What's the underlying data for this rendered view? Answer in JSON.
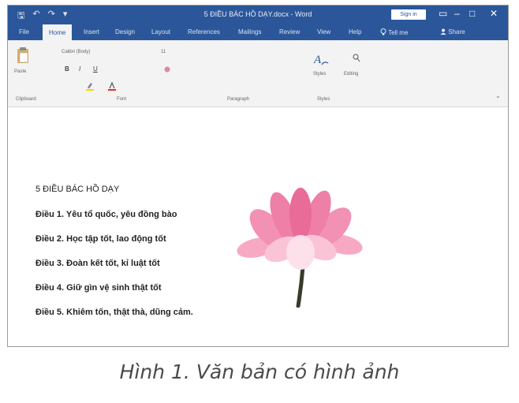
{
  "window": {
    "title": "5 ĐIỀU BÁC HỒ DẠY.docx - Word",
    "sign_in_label": "Sign in",
    "controls": {
      "restore": "▭",
      "minimize": "–",
      "maximize": "□",
      "close": "✕"
    }
  },
  "quick_access": {
    "save_icon": "🖫",
    "undo_icon": "↶",
    "redo_icon": "↷",
    "more_icon": "▾"
  },
  "tabs": [
    {
      "label": "File"
    },
    {
      "label": "Home"
    },
    {
      "label": "Insert"
    },
    {
      "label": "Design"
    },
    {
      "label": "Layout"
    },
    {
      "label": "References"
    },
    {
      "label": "Mailings"
    },
    {
      "label": "Review"
    },
    {
      "label": "View"
    },
    {
      "label": "Help"
    },
    {
      "label": "Tell me"
    },
    {
      "label": "Share"
    }
  ],
  "ribbon": {
    "paste_label": "Paste",
    "font_name": "Calibri (Body)",
    "font_size": "11",
    "bold": "B",
    "italic": "I",
    "underline": "U",
    "styles_label": "Styles",
    "editing_label": "Editing",
    "groups": {
      "clipboard": "Clipboard",
      "font": "Font",
      "paragraph": "Paragraph",
      "styles": "Styles"
    }
  },
  "document": {
    "heading": "5 ĐIỀU BÁC HỒ DẠY",
    "lines": [
      "Điều 1. Yêu tổ quốc, yêu đồng bào",
      "Điều 2. Học tập tốt, lao động tốt",
      "Điều 3. Đoàn kết tốt, kỉ luật tốt",
      "Điều 4. Giữ gìn vệ sinh thật tốt",
      "Điều 5.  Khiêm tốn, thật thà, dũng cảm."
    ]
  },
  "image_icon": "lotus-flower",
  "colors": {
    "accent": "#2b579a",
    "ribbon_bg": "#f3f3f3",
    "petal": "#f08bb0",
    "stem": "#3a3a2a"
  },
  "caption": "Hình 1. Văn bản có hình ảnh"
}
